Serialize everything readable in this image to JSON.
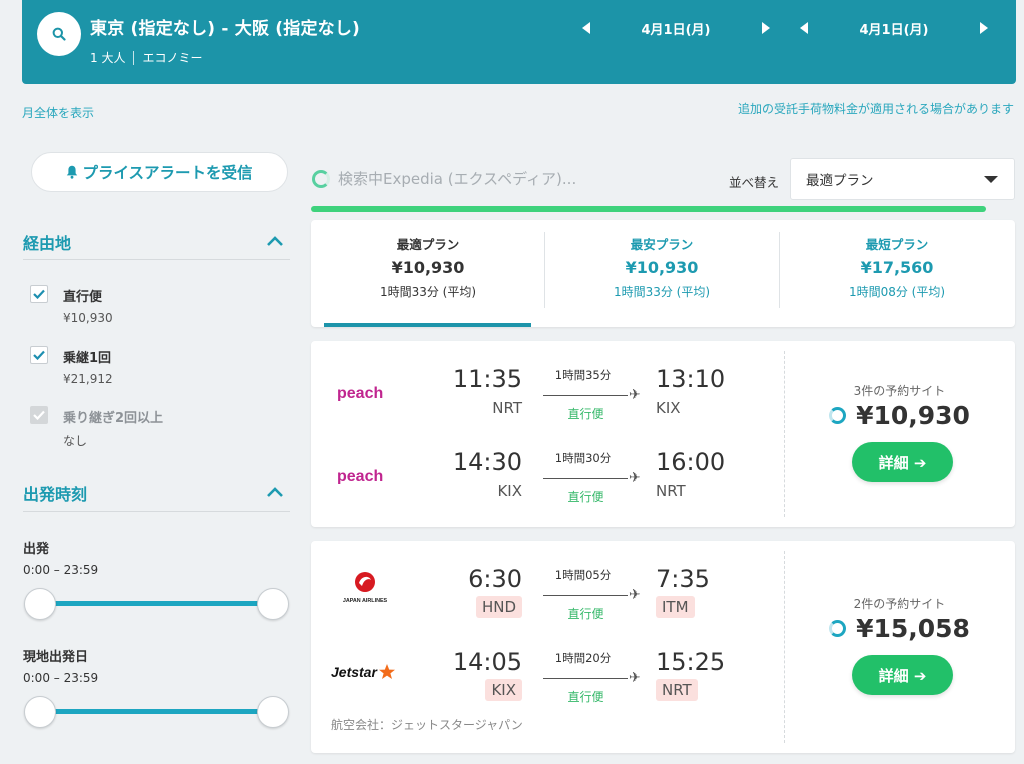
{
  "header": {
    "route": "東京 (指定なし) - 大阪 (指定なし)",
    "passengers": "1 大人",
    "cabin": "エコノミー",
    "depart_date": "4月1日(月)",
    "return_date": "4月1日(月)"
  },
  "links": {
    "month_view": "月全体を表示",
    "baggage_note": "追加の受託手荷物料金が適用される場合があります"
  },
  "sidebar": {
    "price_alert": "プライスアラートを受信",
    "stops_title": "経由地",
    "stops": [
      {
        "label": "直行便",
        "price": "¥10,930",
        "checked": true
      },
      {
        "label": "乗継1回",
        "price": "¥21,912",
        "checked": true
      },
      {
        "label": "乗り継ぎ2回以上",
        "price": "なし",
        "checked": true
      }
    ],
    "times_title": "出発時刻",
    "depart_label": "出発",
    "depart_range": "0:00 – 23:59",
    "local_label": "現地出発日",
    "local_range": "0:00 – 23:59"
  },
  "results": {
    "status": "検索中Expedia (エクスペディア)...",
    "sort_label": "並べ替え",
    "sort_value": "最適プラン",
    "tabs": [
      {
        "title": "最適プラン",
        "price": "¥10,930",
        "duration": "1時間33分 (平均)"
      },
      {
        "title": "最安プラン",
        "price": "¥10,930",
        "duration": "1時間33分 (平均)"
      },
      {
        "title": "最短プラン",
        "price": "¥17,560",
        "duration": "1時間08分 (平均)"
      }
    ],
    "cards": [
      {
        "legs": [
          {
            "airline": "peach",
            "dep": "11:35",
            "dep_code": "NRT",
            "duration": "1時間35分",
            "stops": "直行便",
            "arr": "13:10",
            "arr_code": "KIX"
          },
          {
            "airline": "peach",
            "dep": "14:30",
            "dep_code": "KIX",
            "duration": "1時間30分",
            "stops": "直行便",
            "arr": "16:00",
            "arr_code": "NRT"
          }
        ],
        "sites": "3件の予約サイト",
        "price": "¥10,930",
        "detail": "詳細 ➔"
      },
      {
        "legs": [
          {
            "airline": "JAPAN AIRLINES",
            "dep": "6:30",
            "dep_code": "HND",
            "duration": "1時間05分",
            "stops": "直行便",
            "arr": "7:35",
            "arr_code": "ITM"
          },
          {
            "airline": "Jetstar",
            "dep": "14:05",
            "dep_code": "KIX",
            "duration": "1時間20分",
            "stops": "直行便",
            "arr": "15:25",
            "arr_code": "NRT"
          }
        ],
        "operated_by": "航空会社：ジェットスタージャパン",
        "sites": "2件の予約サイト",
        "price": "¥15,058",
        "detail": "詳細 ➔"
      }
    ]
  },
  "colors": {
    "header": "#1c94a8",
    "accent": "#1d9ab0",
    "green": "#22c069",
    "warn_bg": "#fbe0de"
  }
}
